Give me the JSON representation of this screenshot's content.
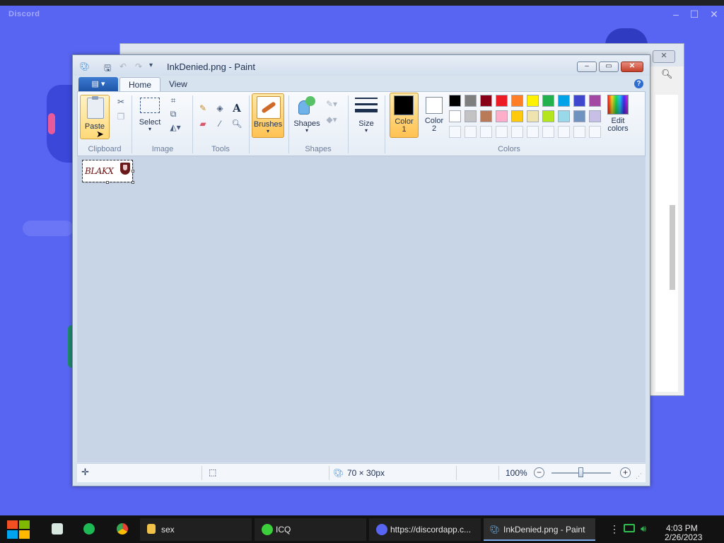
{
  "discord": {
    "app_name": "Discord"
  },
  "paint": {
    "title": "InkDenied.png - Paint",
    "tabs": {
      "home": "Home",
      "view": "View"
    },
    "clipboard": {
      "paste": "Paste",
      "group": "Clipboard"
    },
    "image": {
      "select": "Select",
      "group": "Image"
    },
    "tools": {
      "group": "Tools"
    },
    "brushes": {
      "label": "Brushes"
    },
    "shapes": {
      "label": "Shapes",
      "group": "Shapes"
    },
    "size": {
      "label": "Size"
    },
    "colors": {
      "color1_label": "Color\n1",
      "color2_label": "Color\n2",
      "edit_colors": "Edit\ncolors",
      "group": "Colors",
      "color1": "#000000",
      "color2": "#ffffff",
      "palette_row1": [
        "#000000",
        "#7f7f7f",
        "#880015",
        "#ed1c24",
        "#ff7f27",
        "#fff200",
        "#22b14c",
        "#00a2e8",
        "#3f48cc",
        "#a349a4"
      ],
      "palette_row2": [
        "#ffffff",
        "#c3c3c3",
        "#b97a57",
        "#ffaec9",
        "#ffc90e",
        "#efe4b0",
        "#b5e61d",
        "#99d9ea",
        "#7092be",
        "#c8bfe7"
      ]
    },
    "canvas": {
      "image_text": "BLAKX"
    },
    "status": {
      "image_size": "70 × 30px",
      "zoom": "100%",
      "zoom_value_percent": 100
    }
  },
  "taskbar": {
    "items": [
      {
        "label": "sex"
      },
      {
        "label": "ICQ"
      },
      {
        "label": "https://discordapp.c..."
      },
      {
        "label": "InkDenied.png - Paint"
      }
    ],
    "time": "4:03 PM",
    "date": "2/26/2023"
  }
}
